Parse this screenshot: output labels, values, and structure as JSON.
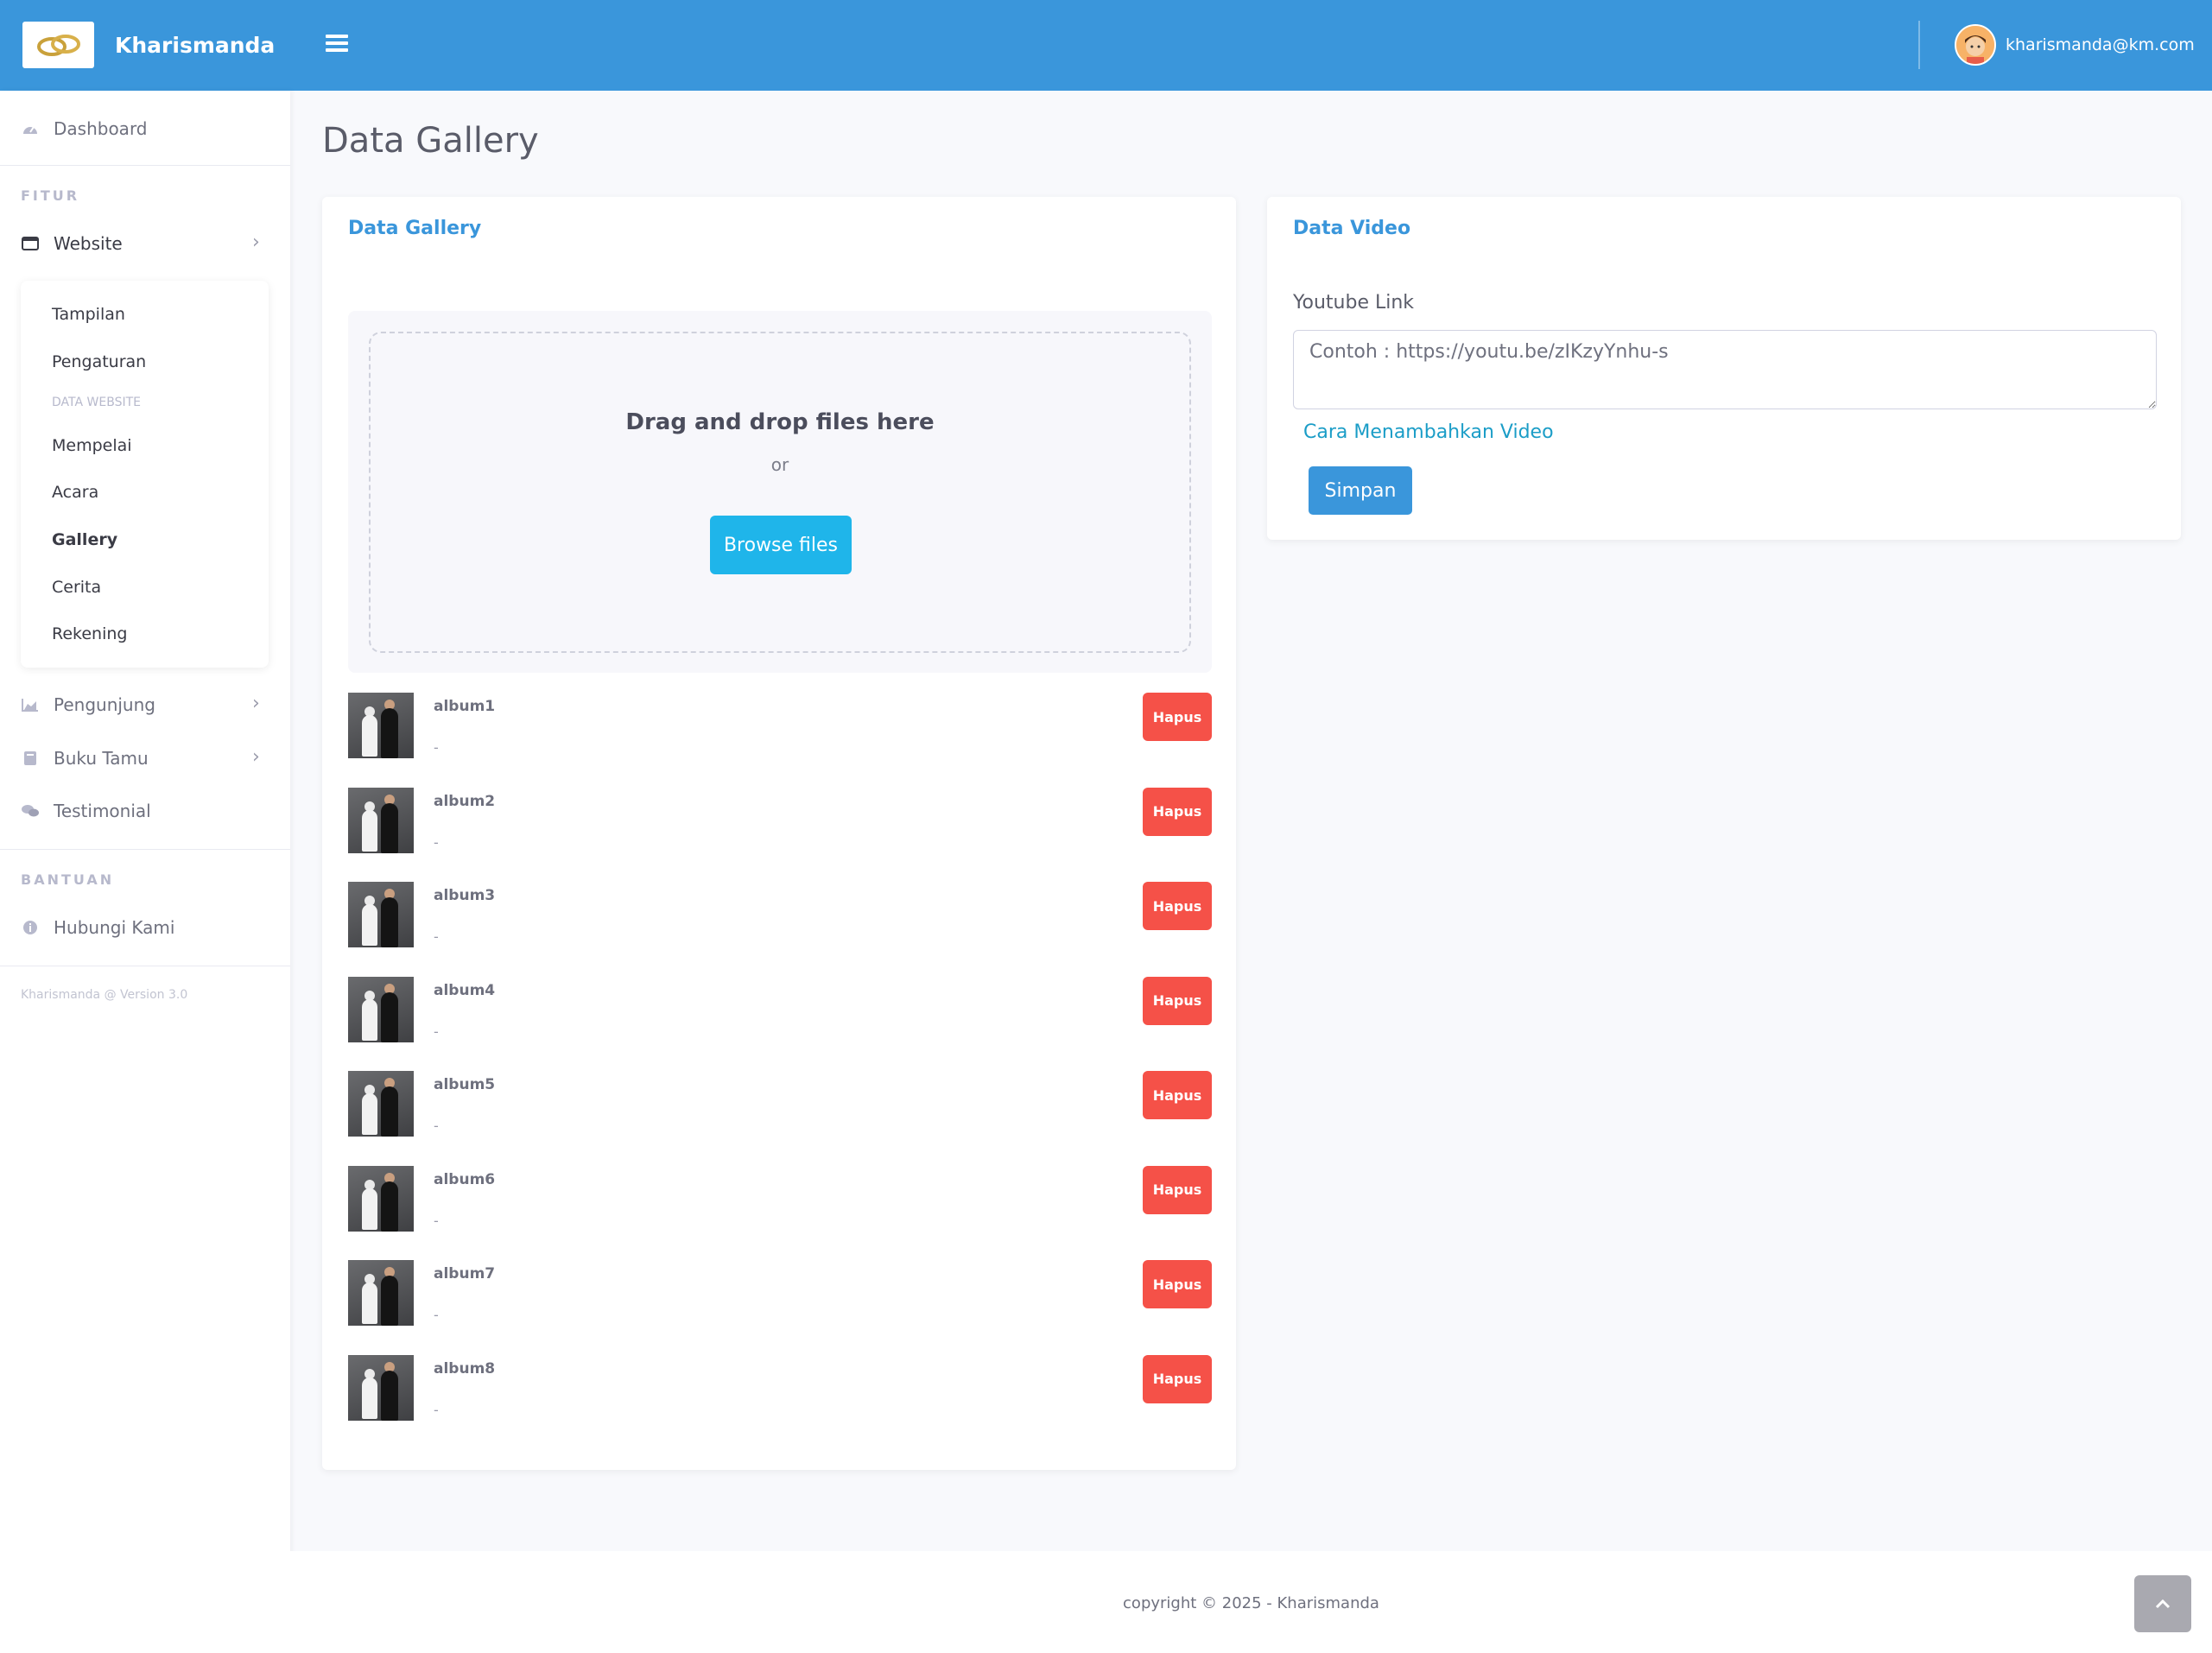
{
  "brand": {
    "name": "Kharismanda",
    "logo_icon": "wedding-rings-icon"
  },
  "user": {
    "email": "kharismanda@km.com",
    "avatar_icon": "user-avatar-icon"
  },
  "sidebar": {
    "dashboard": "Dashboard",
    "heading_fitur": "FITUR",
    "website": "Website",
    "submenu": {
      "tampilan": "Tampilan",
      "pengaturan": "Pengaturan",
      "heading_data": "DATA WEBSITE",
      "mempelai": "Mempelai",
      "acara": "Acara",
      "gallery": "Gallery",
      "cerita": "Cerita",
      "rekening": "Rekening"
    },
    "pengunjung": "Pengunjung",
    "buku_tamu": "Buku Tamu",
    "testimonial": "Testimonial",
    "heading_bantuan": "BANTUAN",
    "hubungi": "Hubungi Kami",
    "version": "Kharismanda @ Version 3.0"
  },
  "page": {
    "title": "Data Gallery"
  },
  "gallery": {
    "title": "Data Gallery",
    "dropzone_title": "Drag and drop files here",
    "dropzone_or": "or",
    "browse_label": "Browse files",
    "delete_label": "Hapus",
    "albums": [
      {
        "name": "album1",
        "desc": "-"
      },
      {
        "name": "album2",
        "desc": "-"
      },
      {
        "name": "album3",
        "desc": "-"
      },
      {
        "name": "album4",
        "desc": "-"
      },
      {
        "name": "album5",
        "desc": "-"
      },
      {
        "name": "album6",
        "desc": "-"
      },
      {
        "name": "album7",
        "desc": "-"
      },
      {
        "name": "album8",
        "desc": "-"
      }
    ]
  },
  "video": {
    "title": "Data Video",
    "field_label": "Youtube Link",
    "placeholder": "Contoh : https://youtu.be/zIKzyYnhu-s",
    "help_link": "Cara Menambahkan Video",
    "save_label": "Simpan"
  },
  "footer": {
    "copyright": "copyright © 2025 - Kharismanda"
  },
  "colors": {
    "primary": "#3a96db",
    "danger": "#f55148",
    "info": "#1fb5ea"
  }
}
